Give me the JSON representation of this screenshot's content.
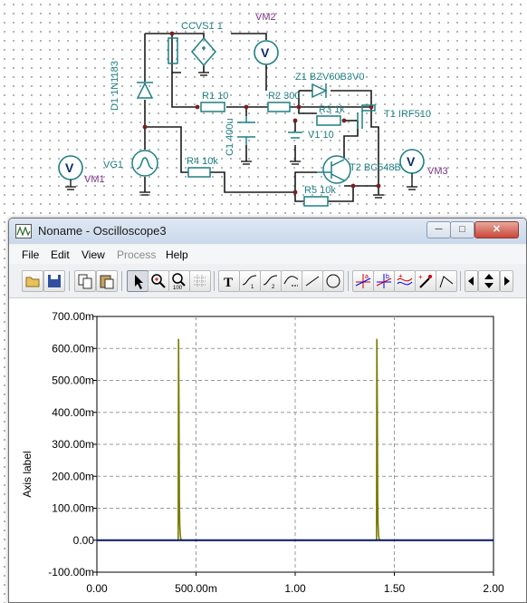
{
  "schematic": {
    "labels": {
      "ccvs": "CCVS1 1",
      "vm2": "VM2",
      "z1": "Z1 BZV60B3V0",
      "d1": "D1 1N1183",
      "r1": "R1 10",
      "r2": "R2 300",
      "t1": "T1 IRF510",
      "r3": "R3 1k",
      "v1": "V1 10",
      "c1": "C1 400u",
      "vg1": "VG1",
      "vm1": "VM1",
      "r4": "R4 10k",
      "t2": "T2 BC548B",
      "vm3": "VM3",
      "r5": "R5 10k",
      "meter_symbol": "V"
    },
    "colors": {
      "wire": "#1a1a1a",
      "component": "#1f7f84",
      "meter_label": "#7d2f86",
      "junction": "#7a1f1f"
    }
  },
  "window": {
    "title": "Noname - Oscilloscope3",
    "menu": [
      "File",
      "Edit",
      "View",
      "Process",
      "Help"
    ],
    "menu_disabled": [
      "Process"
    ],
    "toolbar_icons": [
      "open-icon",
      "save-icon",
      "copy-icon",
      "paste-icon",
      "pointer-icon",
      "zoom-in-icon",
      "zoom-100-icon",
      "grid-icon",
      "text-icon",
      "curve-label-icon",
      "curve-label2-icon",
      "curve-fit-icon",
      "line-icon",
      "ellipse-icon",
      "cursor-a-icon",
      "cursor-b-icon",
      "multi-curve-icon",
      "probe-icon",
      "marker-icon",
      "scroll-left-icon",
      "scroll-updown-icon",
      "scroll-right-icon"
    ]
  },
  "chart_data": {
    "type": "line",
    "ylabel": "Axis label",
    "xlabel": "",
    "x_ticks": [
      "0.00",
      "500.00m",
      "1.00",
      "1.50",
      "2.00"
    ],
    "y_ticks": [
      "700.00m",
      "600.00m",
      "500.00m",
      "400.00m",
      "300.00m",
      "200.00m",
      "100.00m",
      "0.00",
      "-100.00m"
    ],
    "xlim": [
      0,
      2
    ],
    "ylim": [
      -0.1,
      0.7
    ],
    "grid": true,
    "series": [
      {
        "color": "#7a7a00",
        "x": [
          0,
          0.41,
          0.412,
          0.414,
          0.416,
          0.418,
          0.42,
          0.423,
          0.426,
          0.43,
          1.41,
          1.412,
          1.414,
          1.416,
          1.418,
          1.42,
          1.423,
          1.426,
          1.43,
          2.0
        ],
        "y": [
          0,
          0,
          0.63,
          0.4,
          0.13,
          0.05,
          0.02,
          0.005,
          0,
          0,
          0,
          0.63,
          0.4,
          0.13,
          0.05,
          0.02,
          0.005,
          0,
          0,
          0
        ]
      },
      {
        "color": "#0a1a6e",
        "x": [
          0,
          2.0
        ],
        "y": [
          0,
          0
        ]
      }
    ]
  }
}
